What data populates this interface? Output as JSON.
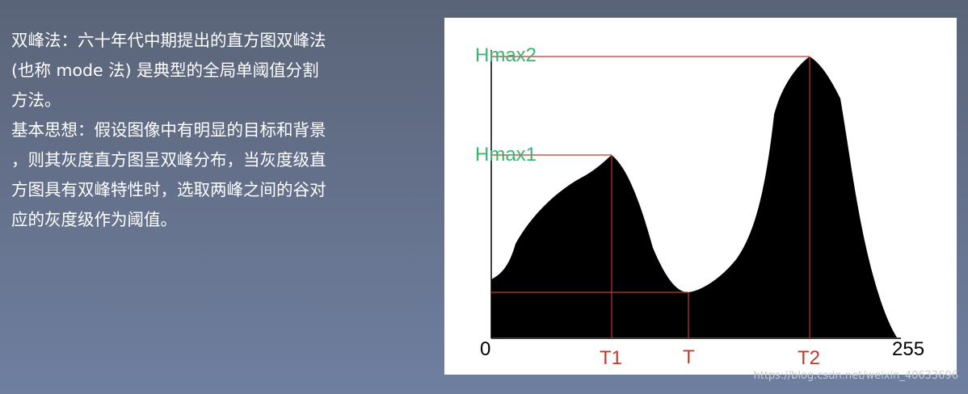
{
  "text": {
    "lines": [
      "双峰法：六十年代中期提出的直方图双峰法",
      "(也称 mode 法) 是典型的全局单阈值分割",
      "方法。",
      "基本思想：假设图像中有明显的目标和背景",
      "，则其灰度直方图呈双峰分布，当灰度级直",
      "方图具有双峰特性时，选取两峰之间的谷对",
      "应的灰度级作为阈值。"
    ]
  },
  "diagram": {
    "label_hmax2": "Hmax2",
    "label_hmax1": "Hmax1",
    "label_origin": "0",
    "label_t1": "T1",
    "label_t": "T",
    "label_t2": "T2",
    "label_255": "255",
    "colors": {
      "fill": "#000000",
      "guide": "#c0392b",
      "hmax_label": "#3cb371",
      "tick_label": "#c0392b",
      "axis_label": "#000000"
    }
  },
  "watermark": "https://blog.csdn.net/weixin_40633696"
}
